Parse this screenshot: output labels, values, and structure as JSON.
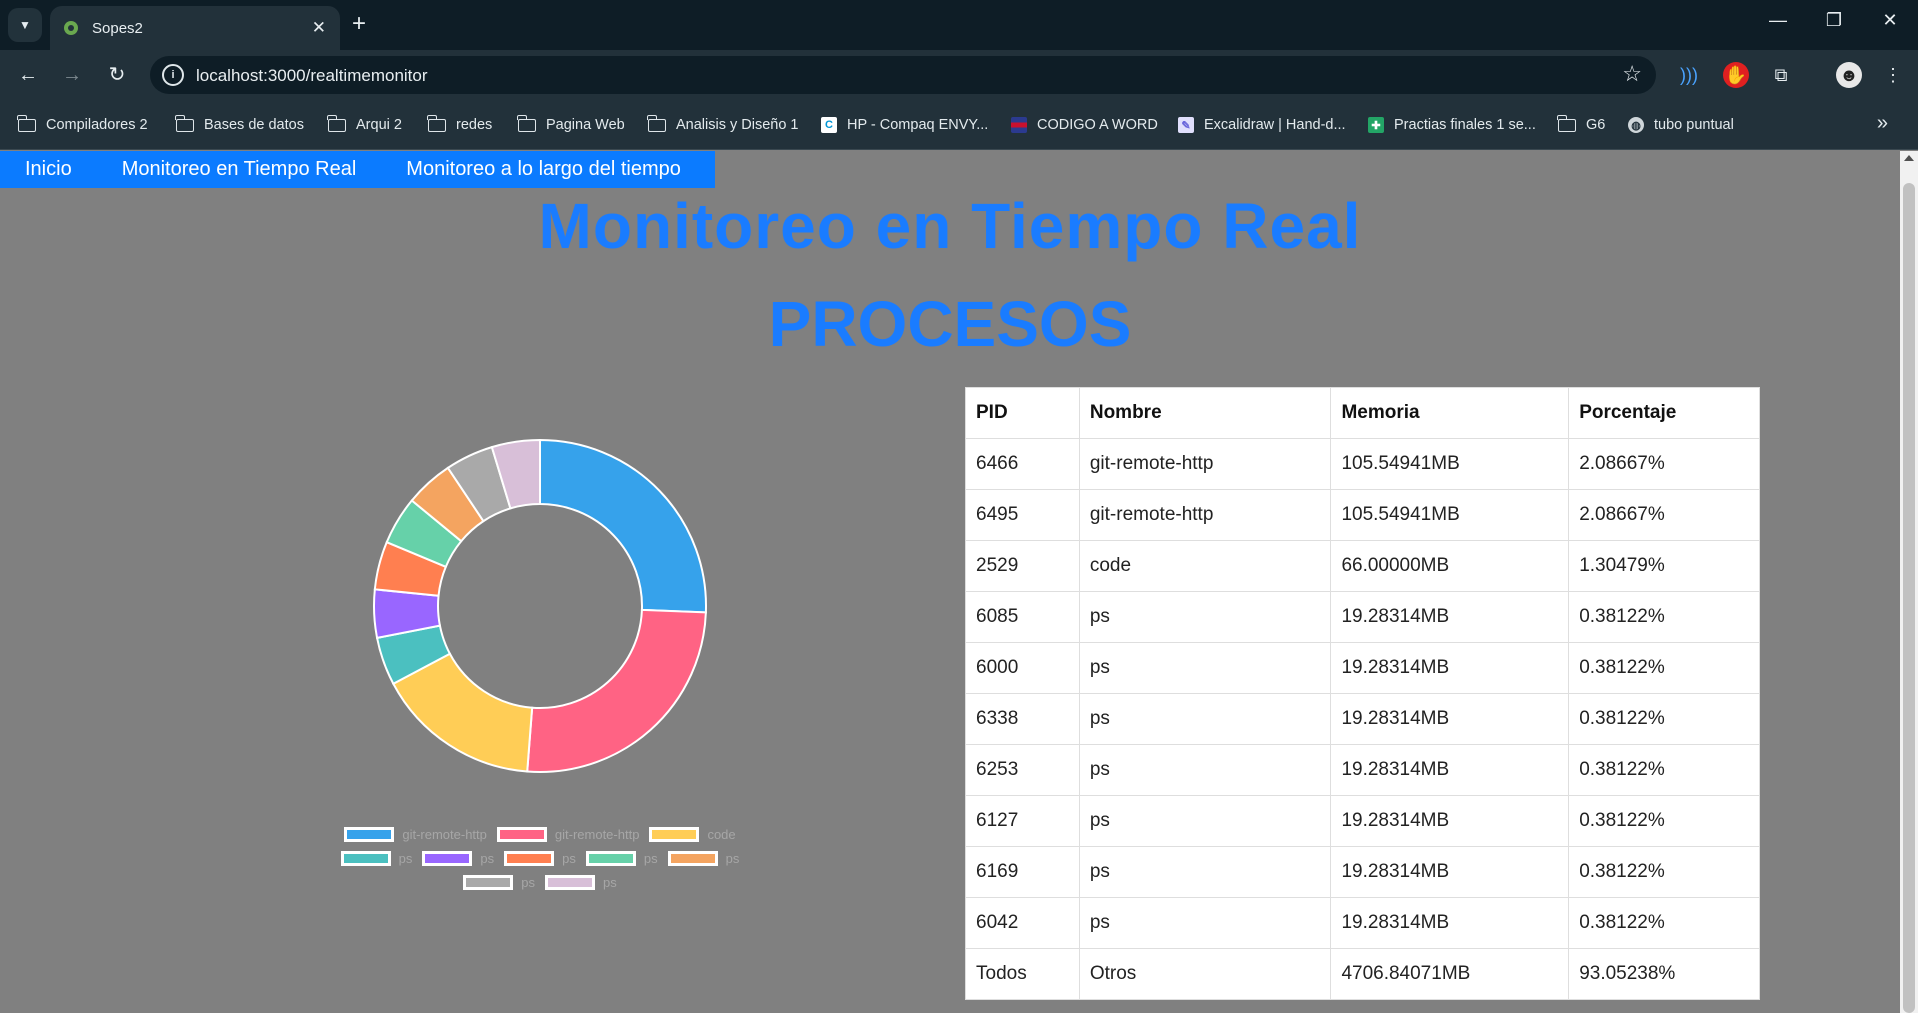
{
  "browser": {
    "tab_title": "Sopes2",
    "url": "localhost:3000/realtimemonitor",
    "bookmarks": [
      {
        "label": "Compiladores 2",
        "icon": "folder-icon"
      },
      {
        "label": "Bases de datos",
        "icon": "folder-icon"
      },
      {
        "label": "Arqui 2",
        "icon": "folder-icon"
      },
      {
        "label": "redes",
        "icon": "folder-icon"
      },
      {
        "label": "Pagina Web",
        "icon": "folder-icon"
      },
      {
        "label": "Analisis y Diseño 1",
        "icon": "folder-icon"
      },
      {
        "label": "HP - Compaq ENVY...",
        "icon": "compaq-icon"
      },
      {
        "label": "CODIGO A WORD",
        "icon": "flag-icon"
      },
      {
        "label": "Excalidraw | Hand-d...",
        "icon": "excalidraw-icon"
      },
      {
        "label": "Practias finales 1 se...",
        "icon": "sheets-icon"
      },
      {
        "label": "G6",
        "icon": "folder-icon"
      },
      {
        "label": "tubo puntual",
        "icon": "globe-icon"
      }
    ]
  },
  "nav": {
    "links": [
      "Inicio",
      "Monitoreo en Tiempo Real",
      "Monitoreo a lo largo del tiempo"
    ]
  },
  "page": {
    "title": "Monitoreo en Tiempo Real",
    "subtitle": "PROCESOS"
  },
  "table": {
    "headers": [
      "PID",
      "Nombre",
      "Memoria",
      "Porcentaje"
    ],
    "rows": [
      [
        "6466",
        "git-remote-http",
        "105.54941MB",
        "2.08667%"
      ],
      [
        "6495",
        "git-remote-http",
        "105.54941MB",
        "2.08667%"
      ],
      [
        "2529",
        "code",
        "66.00000MB",
        "1.30479%"
      ],
      [
        "6085",
        "ps",
        "19.28314MB",
        "0.38122%"
      ],
      [
        "6000",
        "ps",
        "19.28314MB",
        "0.38122%"
      ],
      [
        "6338",
        "ps",
        "19.28314MB",
        "0.38122%"
      ],
      [
        "6253",
        "ps",
        "19.28314MB",
        "0.38122%"
      ],
      [
        "6127",
        "ps",
        "19.28314MB",
        "0.38122%"
      ],
      [
        "6169",
        "ps",
        "19.28314MB",
        "0.38122%"
      ],
      [
        "6042",
        "ps",
        "19.28314MB",
        "0.38122%"
      ],
      [
        "Todos",
        "Otros",
        "4706.84071MB",
        "93.05238%"
      ]
    ]
  },
  "chart_data": {
    "type": "pie",
    "donut": true,
    "categories": [
      "git-remote-http",
      "git-remote-http",
      "code",
      "ps",
      "ps",
      "ps",
      "ps",
      "ps",
      "ps",
      "ps"
    ],
    "values": [
      105.54941,
      105.54941,
      66.0,
      19.28314,
      19.28314,
      19.28314,
      19.28314,
      19.28314,
      19.28314,
      19.28314
    ],
    "colors": [
      "#36a2eb",
      "#ff6384",
      "#ffcd56",
      "#4bc0c0",
      "#9966ff",
      "#ff7f50",
      "#66d1a9",
      "#f4a460",
      "#a9a9a9",
      "#d8bfd8"
    ],
    "legend_position": "bottom",
    "legend_rows": [
      [
        0,
        1,
        2
      ],
      [
        3,
        4,
        5,
        6,
        7
      ],
      [
        8,
        9
      ]
    ]
  }
}
